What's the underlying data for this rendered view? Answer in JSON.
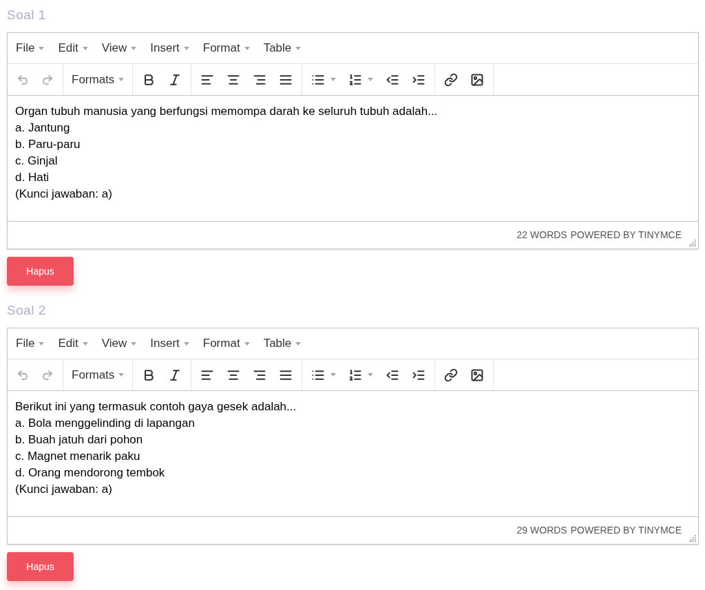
{
  "questions": [
    {
      "label": "Soal 1",
      "menus": [
        "File",
        "Edit",
        "View",
        "Insert",
        "Format",
        "Table"
      ],
      "undo": {
        "disabled": true
      },
      "redo": {
        "disabled": true
      },
      "formats": "Formats",
      "lines": [
        "Organ tubuh manusia yang berfungsi memompa darah ke seluruh tubuh adalah...",
        "a. Jantung",
        "b. Paru-paru",
        "c. Ginjal",
        "d. Hati",
        "(Kunci jawaban: a)"
      ],
      "word_count": "22 WORDS",
      "powered_by": "POWERED BY TINYMCE",
      "delete_button": "Hapus"
    },
    {
      "label": "Soal 2",
      "menus": [
        "File",
        "Edit",
        "View",
        "Insert",
        "Format",
        "Table"
      ],
      "undo": {
        "disabled": true
      },
      "redo": {
        "disabled": true
      },
      "formats": "Formats",
      "lines": [
        "Berikut ini yang termasuk contoh gaya gesek adalah...",
        "a. Bola menggelinding di lapangan",
        "b. Buah jatuh dari pohon",
        "c. Magnet menarik paku",
        "d. Orang mendorong tembok",
        "(Kunci jawaban: a)"
      ],
      "word_count": "29 WORDS",
      "powered_by": "POWERED BY TINYMCE",
      "delete_button": "Hapus"
    }
  ]
}
